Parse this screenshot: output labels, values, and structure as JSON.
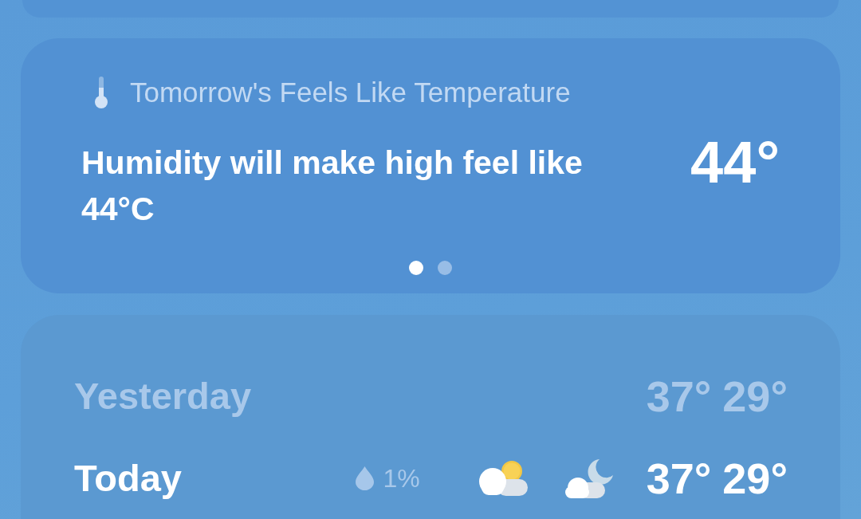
{
  "feels_like_card": {
    "title": "Tomorrow's Feels Like Temperature",
    "message": "Humidity will make high feel like 44°C",
    "temperature": "44°",
    "pages": [
      {
        "selected": true
      },
      {
        "selected": false
      }
    ]
  },
  "daily_forecast": {
    "rows": [
      {
        "day": "Yesterday",
        "past": true,
        "high": "37°",
        "low": "29°"
      },
      {
        "day": "Today",
        "past": false,
        "precipitation": "1%",
        "high": "37°",
        "low": "29°"
      }
    ]
  }
}
